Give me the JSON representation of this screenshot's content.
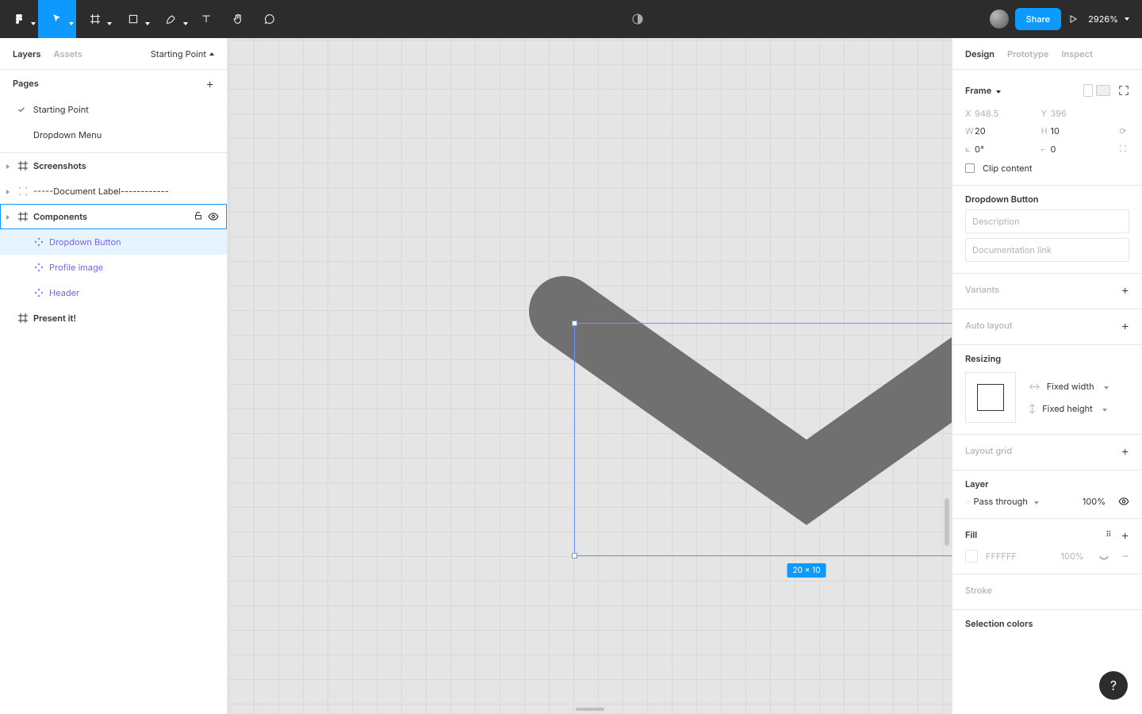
{
  "toolbar": {
    "share": "Share",
    "zoom": "2926%"
  },
  "left": {
    "tabs": {
      "layers": "Layers",
      "assets": "Assets"
    },
    "page_selector": "Starting Point",
    "pages_header": "Pages",
    "pages": [
      {
        "name": "Starting Point",
        "checked": true
      },
      {
        "name": "Dropdown Menu",
        "checked": false
      }
    ],
    "layers": {
      "screenshots": "Screenshots",
      "doclabel": "-----Document Label------------",
      "components": "Components",
      "dropdown_button": "Dropdown Button",
      "profile_image": "Profile image",
      "header": "Header",
      "present": "Present it!"
    }
  },
  "canvas": {
    "dim_badge": "20 × 10"
  },
  "right": {
    "tabs": {
      "design": "Design",
      "prototype": "Prototype",
      "inspect": "Inspect"
    },
    "frame_label": "Frame",
    "x_label": "X",
    "x_val": "948.5",
    "y_label": "Y",
    "y_val": "396",
    "w_label": "W",
    "w_val": "20",
    "h_label": "H",
    "h_val": "10",
    "rot_val": "0°",
    "rad_val": "0",
    "clip": "Clip content",
    "component_name": "Dropdown Button",
    "desc_placeholder": "Description",
    "doc_placeholder": "Documentation link",
    "variants": "Variants",
    "autolayout": "Auto layout",
    "resizing": "Resizing",
    "fixed_w": "Fixed width",
    "fixed_h": "Fixed height",
    "layout_grid": "Layout grid",
    "layer_title": "Layer",
    "blend": "Pass through",
    "opacity": "100%",
    "fill_title": "Fill",
    "fill_hex": "FFFFFF",
    "fill_pct": "100%",
    "stroke": "Stroke",
    "selection_colors": "Selection colors"
  }
}
